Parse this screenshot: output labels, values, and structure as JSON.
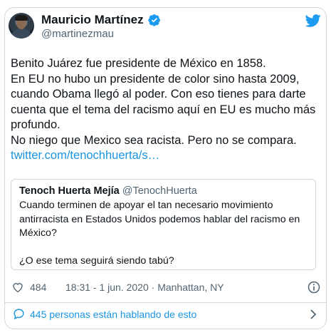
{
  "author": {
    "display_name": "Mauricio Martínez",
    "handle": "@martinezmau",
    "verified": true
  },
  "tweet": {
    "lines": [
      "Benito Juárez fue presidente de México en 1858.",
      "En EU no hubo un presidente de color sino hasta 2009, cuando Obama llegó al poder. Con eso tienes para darte cuenta que el tema del racismo aquí en EU es mucho más profundo.",
      "No niego que Mexico sea racista. Pero no se compara."
    ],
    "link_text": "twitter.com/tenochhuerta/s…"
  },
  "quoted": {
    "display_name": "Tenoch Huerta Mejía",
    "handle": "@TenochHuerta",
    "paragraph1": "Cuando terminen de apoyar el tan necesario movimiento antirracista en Estados Unidos podemos hablar del racismo en México?",
    "paragraph2": "¿O ese tema seguirá siendo tabú?"
  },
  "meta": {
    "likes": "484",
    "timestamp": "18:31 - 1 jun. 2020 · Manhattan, NY"
  },
  "conversation": {
    "label": "445 personas están hablando de esto"
  },
  "icons": {
    "verified": "verified-badge-icon",
    "brand": "twitter-bird-icon",
    "like": "heart-icon",
    "info": "info-icon",
    "reply": "speech-bubble-icon",
    "chevron": "chevron-right-icon"
  },
  "colors": {
    "accent": "#1b95e0",
    "muted": "#536471",
    "border": "#cfd9de"
  }
}
